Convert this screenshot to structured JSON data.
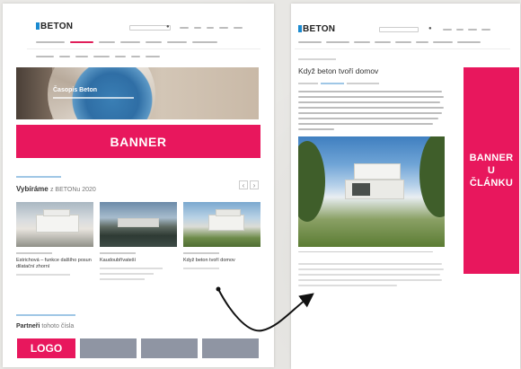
{
  "left_page": {
    "logo_text": "BETON",
    "hero_title": "Časopis Beton",
    "banner_label": "BANNER",
    "section_title_bold": "Vybíráme",
    "section_title_rest": "z BETONu 2020",
    "cards": [
      {
        "title": "Estrichová – funkce dalšího posun dilatační zhorní"
      },
      {
        "title": "Kaudoubřívateší"
      },
      {
        "title": "Když beton tvoří domov"
      }
    ],
    "partners_bold": "Partneři",
    "partners_rest": "tohoto čísla",
    "logo_label": "LOGO"
  },
  "right_page": {
    "logo_text": "BETON",
    "article_title": "Když beton tvoří domov",
    "banner_label": "BANNER\nU\nČLÁNKU"
  },
  "colors": {
    "accent_pink": "#e8175d",
    "link_blue": "#9fc7e6",
    "placeholder_gray": "#8f95a3"
  },
  "icons": [
    "search-icon",
    "chevron-left-icon",
    "chevron-right-icon",
    "curved-arrow-icon"
  ]
}
